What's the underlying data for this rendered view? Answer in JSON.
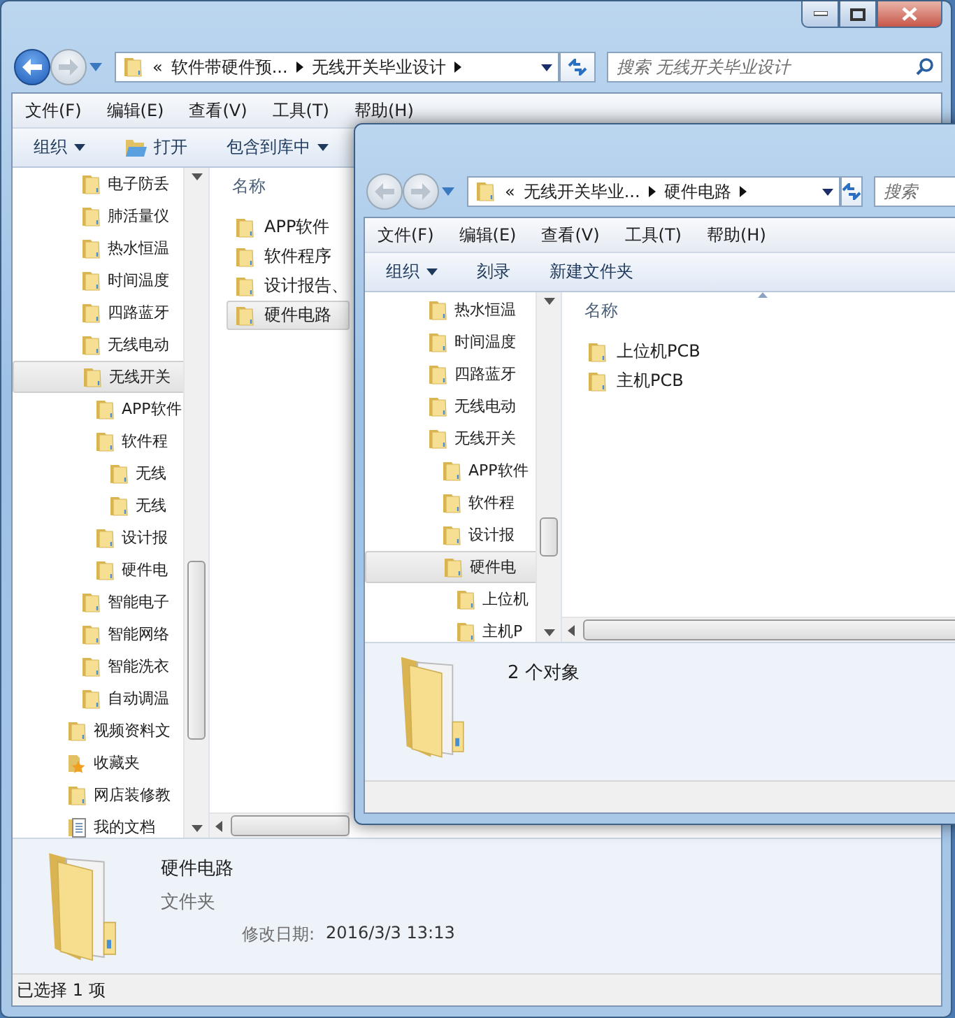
{
  "back_window": {
    "nav": {
      "back_enabled": true
    },
    "address": {
      "overflow": "«",
      "crumbs": [
        "软件带硬件预...",
        "无线开关毕业设计"
      ]
    },
    "search": {
      "placeholder": "搜索 无线开关毕业设计"
    },
    "menu": [
      "文件(F)",
      "编辑(E)",
      "查看(V)",
      "工具(T)",
      "帮助(H)"
    ],
    "toolbar": [
      {
        "label": "组织",
        "kind": "menu"
      },
      {
        "label": "打开",
        "kind": "open"
      },
      {
        "label": "包含到库中",
        "kind": "menu"
      }
    ],
    "tree": {
      "scrolled_parent_children": [
        {
          "label": "电子防丢",
          "selected": false
        },
        {
          "label": "肺活量仪",
          "selected": false
        },
        {
          "label": "热水恒温",
          "selected": false
        },
        {
          "label": "时间温度",
          "selected": false
        },
        {
          "label": "四路蓝牙",
          "selected": false
        },
        {
          "label": "无线电动",
          "selected": false
        },
        {
          "label": "无线开关",
          "selected": true,
          "children": [
            {
              "label": "APP软件",
              "selected": false
            },
            {
              "label": "软件程",
              "selected": false,
              "children": [
                {
                  "label": "无线",
                  "selected": false
                },
                {
                  "label": "无线",
                  "selected": false
                }
              ]
            },
            {
              "label": "设计报",
              "selected": false
            },
            {
              "label": "硬件电",
              "selected": false
            }
          ]
        },
        {
          "label": "智能电子",
          "selected": false
        },
        {
          "label": "智能网络",
          "selected": false
        },
        {
          "label": "智能洗衣",
          "selected": false
        },
        {
          "label": "自动调温",
          "selected": false
        }
      ],
      "items": [
        {
          "label": "视频资料文",
          "kind": "folder",
          "selected": false
        },
        {
          "label": "收藏夹",
          "kind": "favorites",
          "selected": false
        },
        {
          "label": "网店装修教",
          "kind": "folder",
          "selected": false
        },
        {
          "label": "我的文档",
          "kind": "documents",
          "selected": false
        }
      ]
    },
    "list": {
      "column": "名称",
      "items": [
        {
          "name": "APP软件",
          "selected": false
        },
        {
          "name": "软件程序",
          "selected": false
        },
        {
          "name": "设计报告、",
          "selected": false
        },
        {
          "name": "硬件电路",
          "selected": true
        }
      ]
    },
    "details": {
      "kind": "selection",
      "name": "硬件电路",
      "type": "文件夹",
      "date_label": "修改日期:",
      "date": "2016/3/3 13:13"
    },
    "status": "已选择 1 项"
  },
  "front_window": {
    "nav": {
      "back_enabled": false
    },
    "address": {
      "overflow": "«",
      "crumbs": [
        "无线开关毕业...",
        "硬件电路"
      ]
    },
    "search": {
      "placeholder": "搜索"
    },
    "menu": [
      "文件(F)",
      "编辑(E)",
      "查看(V)",
      "工具(T)",
      "帮助(H)"
    ],
    "toolbar": [
      {
        "label": "组织",
        "kind": "menu"
      },
      {
        "label": "刻录",
        "kind": "plain"
      },
      {
        "label": "新建文件夹",
        "kind": "plain"
      }
    ],
    "tree": {
      "scrolled_parent_children": [
        {
          "label": "热水恒温",
          "selected": false
        },
        {
          "label": "时间温度",
          "selected": false
        },
        {
          "label": "四路蓝牙",
          "selected": false
        },
        {
          "label": "无线电动",
          "selected": false
        },
        {
          "label": "无线开关",
          "selected": false,
          "children": [
            {
              "label": "APP软件",
              "selected": false
            },
            {
              "label": "软件程",
              "selected": false
            },
            {
              "label": "设计报",
              "selected": false
            },
            {
              "label": "硬件电",
              "selected": true,
              "children": [
                {
                  "label": "上位机",
                  "selected": false
                },
                {
                  "label": "主机P",
                  "selected": false
                }
              ]
            }
          ]
        }
      ]
    },
    "list": {
      "column": "名称",
      "items": [
        {
          "name": "上位机PCB",
          "selected": false
        },
        {
          "name": "主机PCB",
          "selected": false
        }
      ]
    },
    "details": {
      "kind": "summary",
      "summary": "2 个对象"
    }
  }
}
